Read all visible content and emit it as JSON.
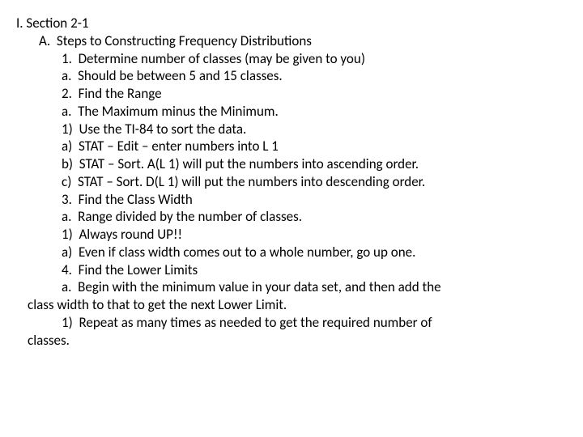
{
  "lines": [
    {
      "cls": "i0",
      "text": "I. Section 2-1"
    },
    {
      "cls": "i1",
      "text": "A.  Steps to Constructing Frequency Distributions"
    },
    {
      "cls": "i2",
      "text": "1.  Determine number of classes (may be given to you)"
    },
    {
      "cls": "i2",
      "text": "a.  Should be between 5 and 15 classes."
    },
    {
      "cls": "i2",
      "text": "2.  Find the Range"
    },
    {
      "cls": "i2",
      "text": "a.  The Maximum minus the Minimum."
    },
    {
      "cls": "i2",
      "text": "1)  Use the TI-84 to sort the data."
    },
    {
      "cls": "i2",
      "text": "a)  STAT – Edit – enter numbers into L 1"
    },
    {
      "cls": "i2",
      "text": "b)  STAT – Sort. A(L 1) will put the numbers into ascending order."
    },
    {
      "cls": "i2",
      "text": "c)  STAT – Sort. D(L 1) will put the numbers into descending order."
    },
    {
      "cls": "i2",
      "text": "3.  Find the Class Width"
    },
    {
      "cls": "i2",
      "text": "a.  Range divided by the number of classes."
    },
    {
      "cls": "i2",
      "text": "1)  Always round UP!!"
    },
    {
      "cls": "i2",
      "text": "a)  Even if class width comes out to a whole number, go up one."
    },
    {
      "cls": "i2",
      "text": "4.  Find the Lower Limits"
    },
    {
      "cls": "i2",
      "text": "a.  Begin with the minimum value in your data set, and then add the"
    },
    {
      "cls": "wrap",
      "text": "class width to that to get the next Lower Limit."
    },
    {
      "cls": "i2",
      "text": "1)  Repeat as many times as needed to get the required number of"
    },
    {
      "cls": "wrap",
      "text": "classes."
    }
  ]
}
